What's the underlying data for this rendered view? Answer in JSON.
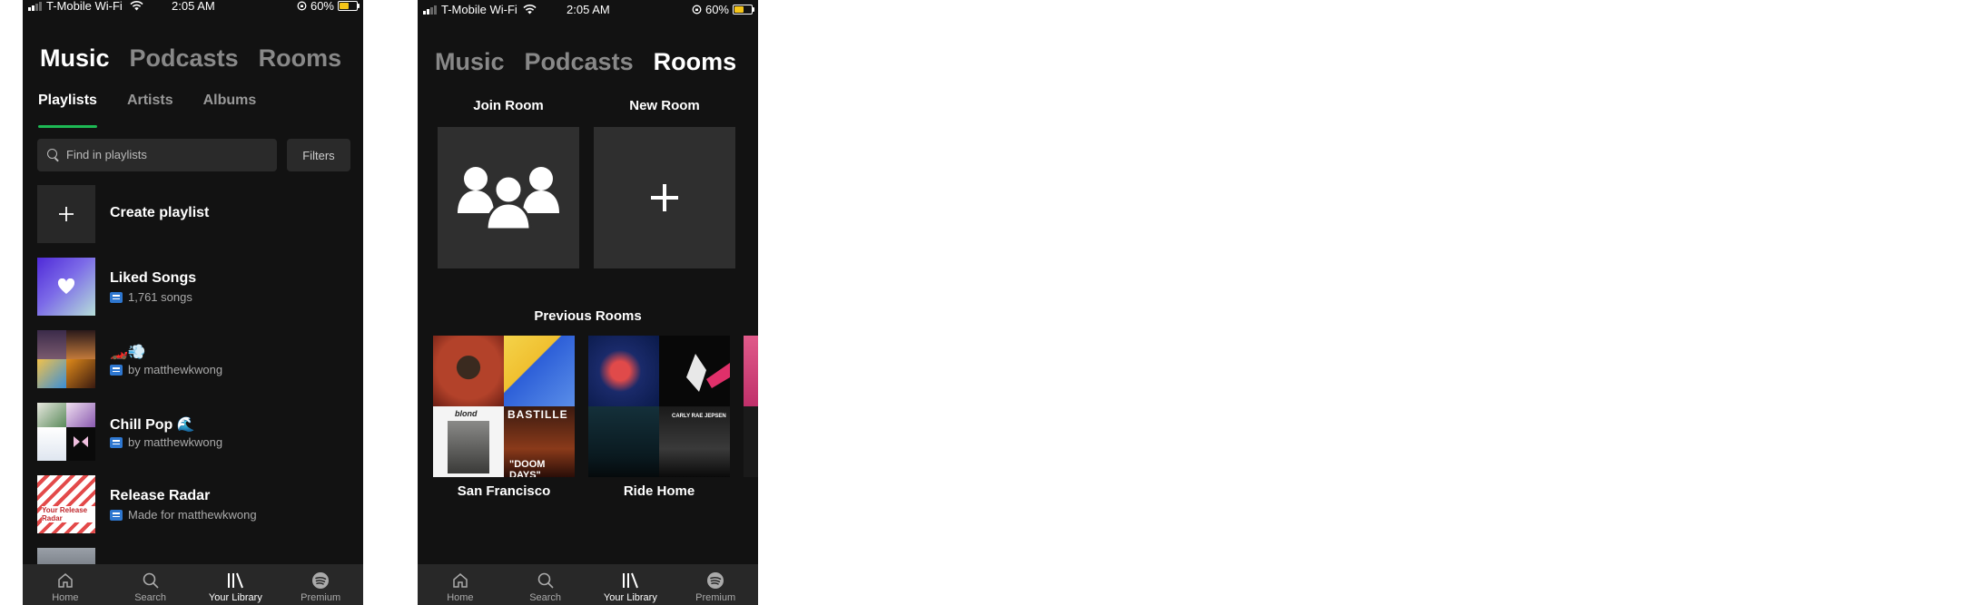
{
  "status": {
    "carrier": "T-Mobile Wi-Fi",
    "time": "2:05 AM",
    "battery": "60%",
    "battery_level": 0.6
  },
  "screen1": {
    "tabs": [
      "Music",
      "Podcasts",
      "Rooms"
    ],
    "subtabs": [
      "Playlists",
      "Artists",
      "Albums"
    ],
    "search": {
      "placeholder": "Find in playlists"
    },
    "filters_label": "Filters",
    "create_label": "Create playlist",
    "playlists": [
      {
        "title": "Liked Songs",
        "subtitle": "1,761 songs"
      },
      {
        "title": "🏎️💨",
        "subtitle": "by matthewkwong"
      },
      {
        "title": "Chill Pop 🌊",
        "subtitle": "by matthewkwong"
      },
      {
        "title": "Release Radar",
        "subtitle": "Made for matthewkwong"
      }
    ],
    "radar_art_text": "Your Release Radar"
  },
  "screen2": {
    "tabs": [
      "Music",
      "Podcasts",
      "Rooms"
    ],
    "join_label": "Join Room",
    "new_label": "New Room",
    "previous_label": "Previous Rooms",
    "rooms": [
      {
        "name": "San Francisco",
        "art_text": [
          "blond",
          "BASTILLE",
          "\"DOOM DAYS\""
        ]
      },
      {
        "name": "Ride Home",
        "art_text": [
          "CARLY RAE JEPSEN"
        ]
      }
    ]
  },
  "nav": [
    "Home",
    "Search",
    "Your Library",
    "Premium"
  ],
  "colors": {
    "background": "#121212",
    "accent": "#1db954",
    "download_badge": "#2e77d0",
    "nav_bar": "#282828"
  }
}
